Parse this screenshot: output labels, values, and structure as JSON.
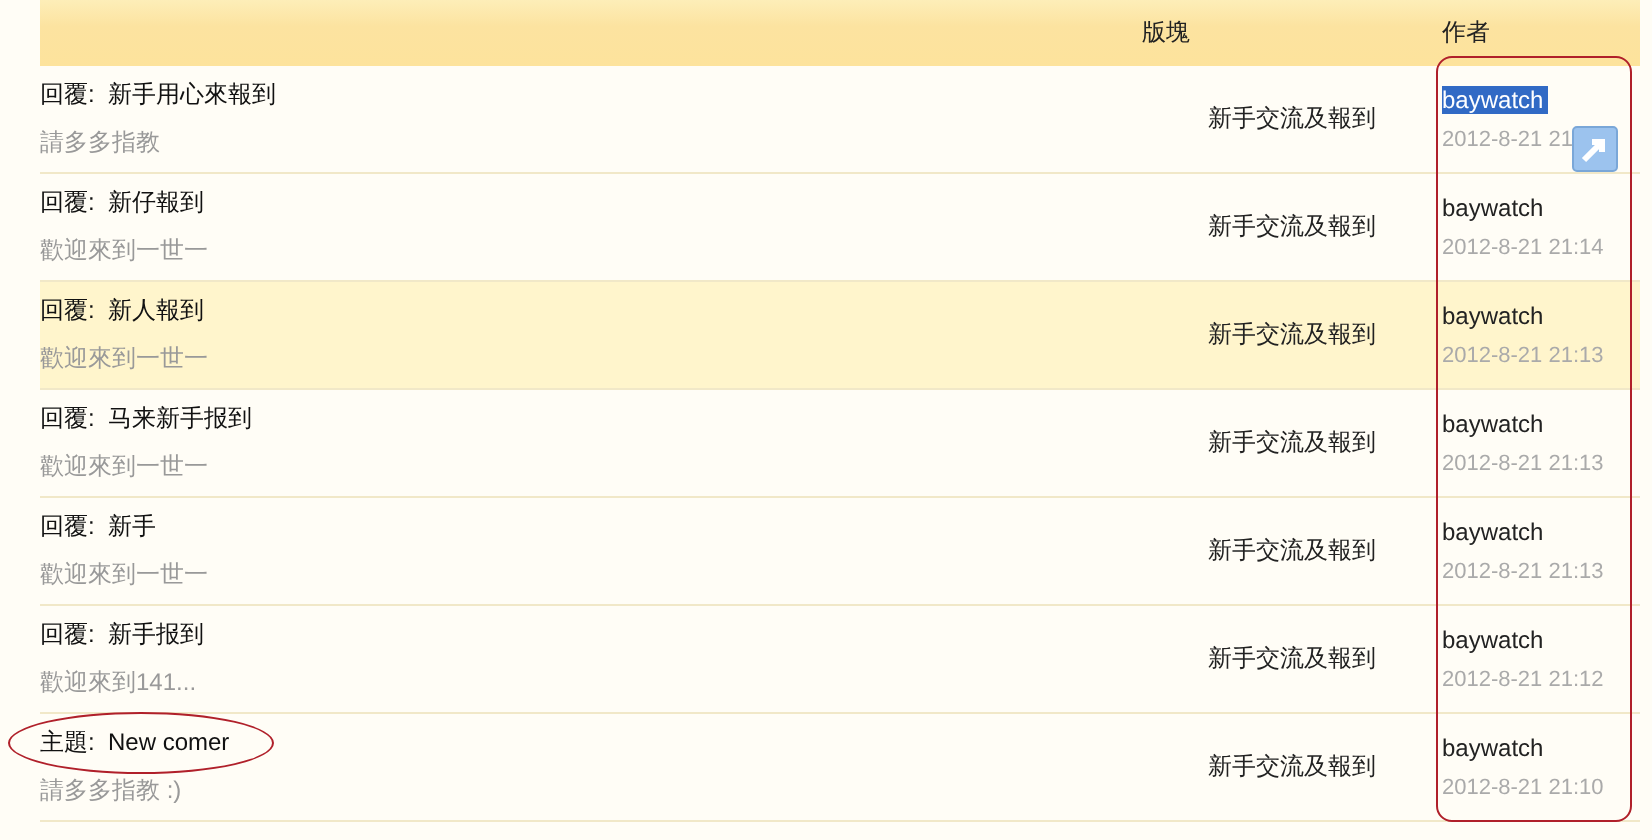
{
  "table": {
    "columns": [
      {
        "label": "版塊"
      },
      {
        "label": "作者"
      }
    ],
    "rows": [
      {
        "title": "回覆:  新手用心來報到",
        "summary": "請多多指教",
        "board": "新手交流及報到",
        "author": "baywatch",
        "time": "2012-8-21 21",
        "highlighted": false,
        "author_selected": true
      },
      {
        "title": "回覆:  新仔報到",
        "summary": "歡迎來到一世一",
        "board": "新手交流及報到",
        "author": "baywatch",
        "time": "2012-8-21 21:14",
        "highlighted": false,
        "author_selected": false
      },
      {
        "title": "回覆:  新人報到",
        "summary": "歡迎來到一世一",
        "board": "新手交流及報到",
        "author": "baywatch",
        "time": "2012-8-21 21:13",
        "highlighted": true,
        "author_selected": false
      },
      {
        "title": "回覆:  马来新手报到",
        "summary": "歡迎來到一世一",
        "board": "新手交流及報到",
        "author": "baywatch",
        "time": "2012-8-21 21:13",
        "highlighted": false,
        "author_selected": false
      },
      {
        "title": "回覆:  新手",
        "summary": "歡迎來到一世一",
        "board": "新手交流及報到",
        "author": "baywatch",
        "time": "2012-8-21 21:13",
        "highlighted": false,
        "author_selected": false
      },
      {
        "title": "回覆:  新手报到",
        "summary": "歡迎來到141...",
        "board": "新手交流及報到",
        "author": "baywatch",
        "time": "2012-8-21 21:12",
        "highlighted": false,
        "author_selected": false
      },
      {
        "title": "主題:  New comer",
        "summary": "請多多指教 :)",
        "board": "新手交流及報到",
        "author": "baywatch",
        "time": "2012-8-21 21:10",
        "highlighted": false,
        "author_selected": false
      }
    ]
  }
}
